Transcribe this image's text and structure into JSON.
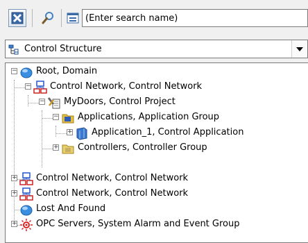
{
  "toolbar": {
    "clear_icon": "close-icon",
    "search_icon": "search-icon",
    "view_icon": "view-options-icon",
    "search_placeholder": "(Enter search name)"
  },
  "structure_selector": {
    "selected": "Control Structure"
  },
  "tree": {
    "items": [
      {
        "label": "Root, Domain",
        "icon": "globe-icon",
        "expander": "−"
      },
      {
        "label": "Control Network, Control Network",
        "icon": "network-icon",
        "expander": "−"
      },
      {
        "label": "MyDoors, Control Project",
        "icon": "project-tools-icon",
        "expander": "−"
      },
      {
        "label": "Applications, Application Group",
        "icon": "folder-icon",
        "expander": "−"
      },
      {
        "label": "Application_1, Control Application",
        "icon": "application-icon",
        "expander": "+"
      },
      {
        "label": "Controllers, Controller Group",
        "icon": "folder-icon",
        "expander": "+"
      },
      {
        "label": "Control Network, Control Network",
        "icon": "network-icon",
        "expander": "+"
      },
      {
        "label": "Control Network, Control Network",
        "icon": "network-icon",
        "expander": "+"
      },
      {
        "label": "Lost And Found",
        "icon": "globe-icon",
        "expander": ""
      },
      {
        "label": "OPC Servers, System Alarm and Event Group",
        "icon": "alarm-icon",
        "expander": "+"
      }
    ]
  },
  "colors": {
    "network_blue": "#2255cc",
    "network_red": "#cc2222",
    "folder_yellow": "#e8c040",
    "globe_blue": "#3a8ee0"
  }
}
